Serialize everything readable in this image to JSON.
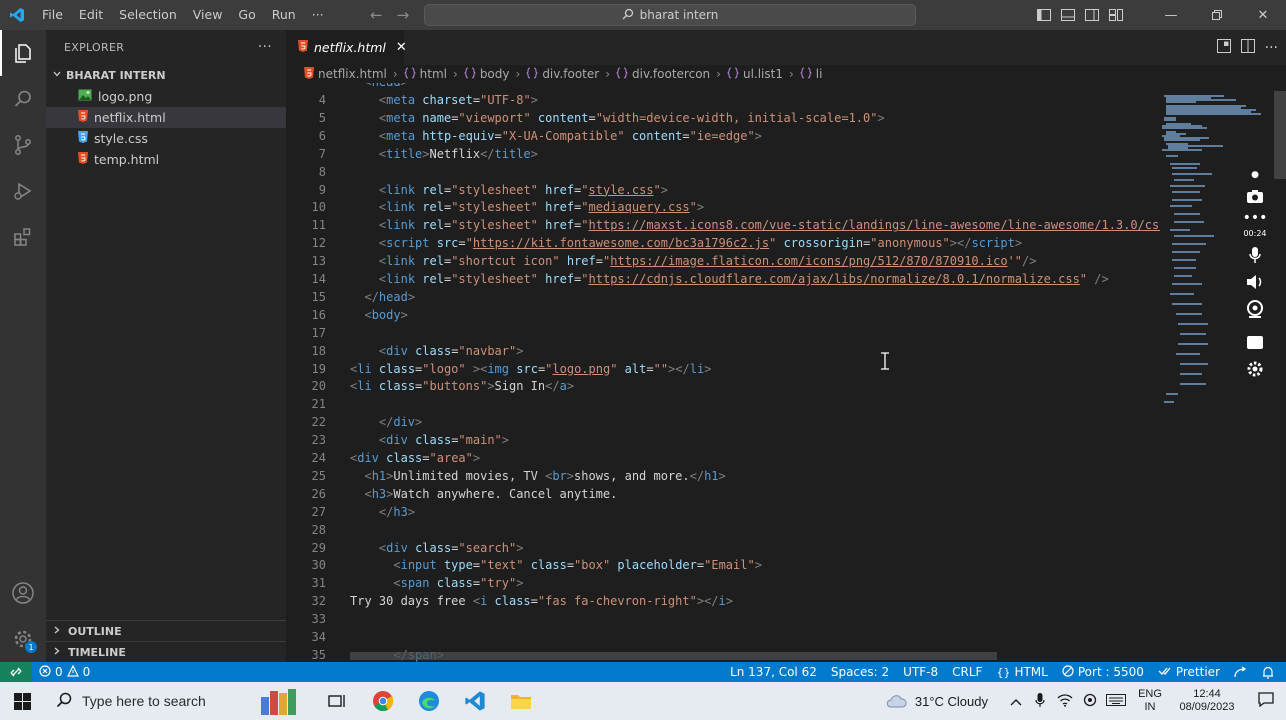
{
  "window": {
    "menus": [
      "File",
      "Edit",
      "Selection",
      "View",
      "Go",
      "Run",
      "···"
    ],
    "search_text": "bharat intern"
  },
  "sidebar": {
    "title": "EXPLORER",
    "more": "···",
    "folder": "BHARAT INTERN",
    "files": [
      {
        "name": "logo.png",
        "type": "image",
        "selected": false
      },
      {
        "name": "netflix.html",
        "type": "html",
        "selected": true
      },
      {
        "name": "style.css",
        "type": "css",
        "selected": false
      },
      {
        "name": "temp.html",
        "type": "html",
        "selected": false
      }
    ],
    "outline": "OUTLINE",
    "timeline": "TIMELINE"
  },
  "activity_badge": "1",
  "editor": {
    "tab_label": "netflix.html",
    "breadcrumbs": [
      "netflix.html",
      "html",
      "body",
      "div.footer",
      "div.footercon",
      "ul.list1",
      "li"
    ]
  },
  "code": [
    {
      "n": "4",
      "html": "    <span class=\"t-gray\">&lt;</span><span class=\"t-tag\">meta</span> <span class=\"t-attr\">charset</span>=<span class=\"t-str\">\"UTF-8\"</span><span class=\"t-gray\">&gt;</span>"
    },
    {
      "n": "5",
      "html": "    <span class=\"t-gray\">&lt;</span><span class=\"t-tag\">meta</span> <span class=\"t-attr\">name</span>=<span class=\"t-str\">\"viewport\"</span> <span class=\"t-attr\">content</span>=<span class=\"t-str\">\"width=device-width, initial-scale=1.0\"</span><span class=\"t-gray\">&gt;</span>"
    },
    {
      "n": "6",
      "html": "    <span class=\"t-gray\">&lt;</span><span class=\"t-tag\">meta</span> <span class=\"t-attr\">http-equiv</span>=<span class=\"t-str\">\"X-UA-Compatible\"</span> <span class=\"t-attr\">content</span>=<span class=\"t-str\">\"ie=edge\"</span><span class=\"t-gray\">&gt;</span>"
    },
    {
      "n": "7",
      "html": "    <span class=\"t-gray\">&lt;</span><span class=\"t-tag\">title</span><span class=\"t-gray\">&gt;</span>Netflix<span class=\"t-gray\">&lt;/</span><span class=\"t-tag\">title</span><span class=\"t-gray\">&gt;</span>"
    },
    {
      "n": "8",
      "html": ""
    },
    {
      "n": "9",
      "html": "    <span class=\"t-gray\">&lt;</span><span class=\"t-tag\">link</span> <span class=\"t-attr\">rel</span>=<span class=\"t-str\">\"stylesheet\"</span> <span class=\"t-attr\">href</span>=<span class=\"t-str\">\"</span><span class=\"t-link\">style.css</span><span class=\"t-str\">\"</span><span class=\"t-gray\">&gt;</span>"
    },
    {
      "n": "10",
      "html": "    <span class=\"t-gray\">&lt;</span><span class=\"t-tag\">link</span> <span class=\"t-attr\">rel</span>=<span class=\"t-str\">\"stylesheet\"</span> <span class=\"t-attr\">href</span>=<span class=\"t-str\">\"</span><span class=\"t-link\">mediaquery.css</span><span class=\"t-str\">\"</span><span class=\"t-gray\">&gt;</span>"
    },
    {
      "n": "11",
      "html": "    <span class=\"t-gray\">&lt;</span><span class=\"t-tag\">link</span> <span class=\"t-attr\">rel</span>=<span class=\"t-str\">\"stylesheet\"</span> <span class=\"t-attr\">href</span>=<span class=\"t-str\">\"</span><span class=\"t-link\">https://maxst.icons8.com/vue-static/landings/line-awesome/line-awesome/1.3.0/css</span>"
    },
    {
      "n": "12",
      "html": "    <span class=\"t-gray\">&lt;</span><span class=\"t-tag\">script</span> <span class=\"t-attr\">src</span>=<span class=\"t-str\">\"</span><span class=\"t-link\">https://kit.fontawesome.com/bc3a1796c2.js</span><span class=\"t-str\">\"</span> <span class=\"t-attr\">crossorigin</span>=<span class=\"t-str\">\"anonymous\"</span><span class=\"t-gray\">&gt;&lt;/</span><span class=\"t-tag\">script</span><span class=\"t-gray\">&gt;</span>"
    },
    {
      "n": "13",
      "html": "    <span class=\"t-gray\">&lt;</span><span class=\"t-tag\">link</span> <span class=\"t-attr\">rel</span>=<span class=\"t-str\">\"shortcut icon\"</span> <span class=\"t-attr\">href</span>=<span class=\"t-str\">\"</span><span class=\"t-link\">https://image.flaticon.com/icons/png/512/870/870910.ico</span><span class=\"t-str\">'\"</span><span class=\"t-gray\">/&gt;</span>"
    },
    {
      "n": "14",
      "html": "    <span class=\"t-gray\">&lt;</span><span class=\"t-tag\">link</span> <span class=\"t-attr\">rel</span>=<span class=\"t-str\">\"stylesheet\"</span> <span class=\"t-attr\">href</span>=<span class=\"t-str\">\"</span><span class=\"t-link\">https://cdnjs.cloudflare.com/ajax/libs/normalize/8.0.1/normalize.css</span><span class=\"t-str\">\"</span> <span class=\"t-gray\">/&gt;</span>"
    },
    {
      "n": "15",
      "html": "  <span class=\"t-gray\">&lt;/</span><span class=\"t-tag\">head</span><span class=\"t-gray\">&gt;</span>"
    },
    {
      "n": "16",
      "html": "  <span class=\"t-gray\">&lt;</span><span class=\"t-tag\">body</span><span class=\"t-gray\">&gt;</span>"
    },
    {
      "n": "17",
      "html": ""
    },
    {
      "n": "18",
      "html": "    <span class=\"t-gray\">&lt;</span><span class=\"t-tag\">div</span> <span class=\"t-attr\">class</span>=<span class=\"t-str\">\"navbar\"</span><span class=\"t-gray\">&gt;</span>"
    },
    {
      "n": "19",
      "html": "<span class=\"t-gray\">&lt;</span><span class=\"t-tag\">li</span> <span class=\"t-attr\">class</span>=<span class=\"t-str\">\"logo\"</span> <span class=\"t-gray\">&gt;&lt;</span><span class=\"t-tag\">img</span> <span class=\"t-attr\">src</span>=<span class=\"t-str\">\"</span><span class=\"t-link\">logo.png</span><span class=\"t-str\">\"</span> <span class=\"t-attr\">alt</span>=<span class=\"t-str\">\"\"</span><span class=\"t-gray\">&gt;&lt;/</span><span class=\"t-tag\">li</span><span class=\"t-gray\">&gt;</span>"
    },
    {
      "n": "20",
      "html": "<span class=\"t-gray\">&lt;</span><span class=\"t-tag\">li</span> <span class=\"t-attr\">class</span>=<span class=\"t-str\">\"buttons\"</span><span class=\"t-gray\">&gt;</span>Sign In<span class=\"t-gray\">&lt;/</span><span class=\"t-tag\">a</span><span class=\"t-gray\">&gt;</span>"
    },
    {
      "n": "21",
      "html": ""
    },
    {
      "n": "22",
      "html": "    <span class=\"t-gray\">&lt;/</span><span class=\"t-tag\">div</span><span class=\"t-gray\">&gt;</span>"
    },
    {
      "n": "23",
      "html": "    <span class=\"t-gray\">&lt;</span><span class=\"t-tag\">div</span> <span class=\"t-attr\">class</span>=<span class=\"t-str\">\"main\"</span><span class=\"t-gray\">&gt;</span>"
    },
    {
      "n": "24",
      "html": "<span class=\"t-gray\">&lt;</span><span class=\"t-tag\">div</span> <span class=\"t-attr\">class</span>=<span class=\"t-str\">\"area\"</span><span class=\"t-gray\">&gt;</span>"
    },
    {
      "n": "25",
      "html": "  <span class=\"t-gray\">&lt;</span><span class=\"t-tag\">h1</span><span class=\"t-gray\">&gt;</span>Unlimited movies, TV <span class=\"t-gray\">&lt;</span><span class=\"t-tag\">br</span><span class=\"t-gray\">&gt;</span>shows, and more.<span class=\"t-gray\">&lt;/</span><span class=\"t-tag\">h1</span><span class=\"t-gray\">&gt;</span>"
    },
    {
      "n": "26",
      "html": "  <span class=\"t-gray\">&lt;</span><span class=\"t-tag\">h3</span><span class=\"t-gray\">&gt;</span>Watch anywhere. Cancel anytime."
    },
    {
      "n": "27",
      "html": "    <span class=\"t-gray\">&lt;/</span><span class=\"t-tag\">h3</span><span class=\"t-gray\">&gt;</span>"
    },
    {
      "n": "28",
      "html": ""
    },
    {
      "n": "29",
      "html": "    <span class=\"t-gray\">&lt;</span><span class=\"t-tag\">div</span> <span class=\"t-attr\">class</span>=<span class=\"t-str\">\"search\"</span><span class=\"t-gray\">&gt;</span>"
    },
    {
      "n": "30",
      "html": "      <span class=\"t-gray\">&lt;</span><span class=\"t-tag\">input</span> <span class=\"t-attr\">type</span>=<span class=\"t-str\">\"text\"</span> <span class=\"t-attr\">class</span>=<span class=\"t-str\">\"box\"</span> <span class=\"t-attr\">placeholder</span>=<span class=\"t-str\">\"Email\"</span><span class=\"t-gray\">&gt;</span>"
    },
    {
      "n": "31",
      "html": "      <span class=\"t-gray\">&lt;</span><span class=\"t-tag\">span</span> <span class=\"t-attr\">class</span>=<span class=\"t-str\">\"try\"</span><span class=\"t-gray\">&gt;</span>"
    },
    {
      "n": "32",
      "html": "Try 30 days free <span class=\"t-gray\">&lt;</span><span class=\"t-tag\">i</span> <span class=\"t-attr\">class</span>=<span class=\"t-str\">\"fas fa-chevron-right\"</span><span class=\"t-gray\">&gt;&lt;/</span><span class=\"t-tag\">i</span><span class=\"t-gray\">&gt;</span>"
    },
    {
      "n": "33",
      "html": ""
    },
    {
      "n": "34",
      "html": ""
    },
    {
      "n": "35",
      "html": "      <span class=\"t-gray\">&lt;/</span><span class=\"t-tag\">span</span><span class=\"t-gray\">&gt;</span>"
    }
  ],
  "recorder": {
    "time": "00:24"
  },
  "status": {
    "errors": "0",
    "warnings": "0",
    "position": "Ln 137, Col 62",
    "spaces": "Spaces: 2",
    "encoding": "UTF-8",
    "eol": "CRLF",
    "language": "HTML",
    "port": "Port : 5500",
    "prettier": "Prettier"
  },
  "taskbar": {
    "search_placeholder": "Type here to search",
    "weather": "31°C  Cloudy",
    "lang_top": "ENG",
    "lang_bottom": "IN",
    "time": "12:44",
    "date": "08/09/2023"
  },
  "colors": {
    "accent": "#007acc",
    "html_icon": "#e44d26",
    "css_icon": "#42a5f5",
    "image_icon": "#4caf50"
  }
}
